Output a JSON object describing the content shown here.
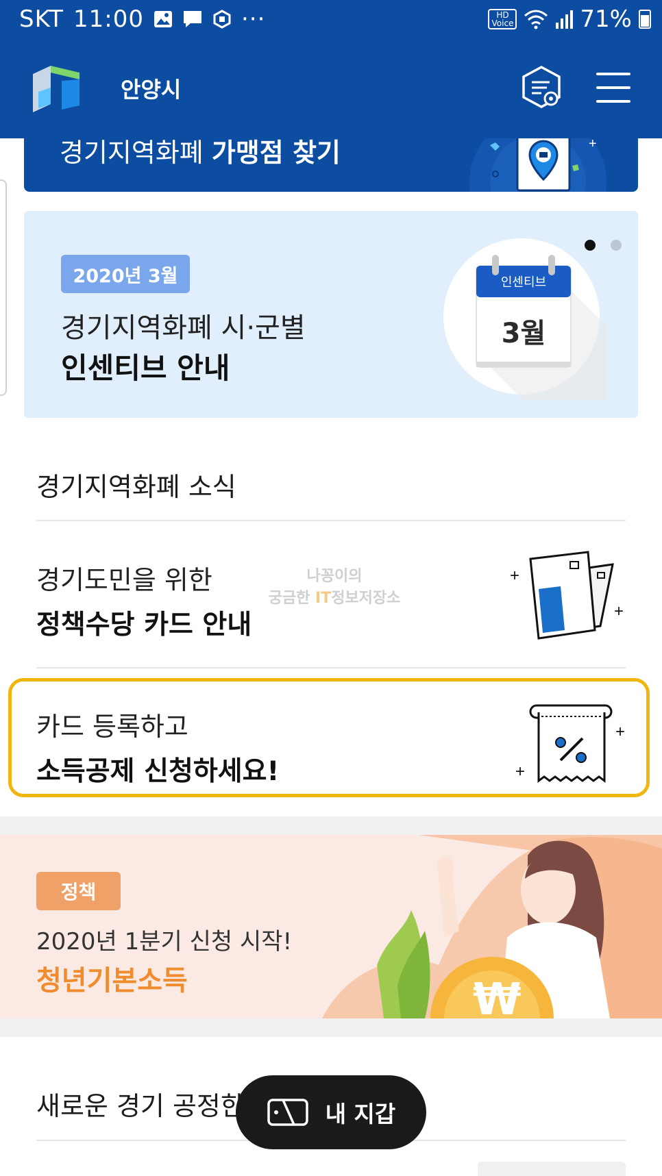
{
  "status_bar": {
    "carrier": "SKT",
    "time": "11:00",
    "overflow": "···",
    "hd_line1": "HD",
    "hd_line2": "Voice",
    "battery": "71%"
  },
  "header": {
    "city": "안양시",
    "icons": [
      "gyeonggi-logo-icon",
      "settings-document-icon",
      "hamburger-menu-icon"
    ]
  },
  "store_banner": {
    "text_regular": "경기지역화폐 ",
    "text_bold": "가맹점 찾기"
  },
  "incentive_banner": {
    "badge": "2020년 3월",
    "line1": "경기지역화폐 시·군별",
    "line2": "인센티브 안내",
    "calendar_header": "인센티브",
    "calendar_month": "3월",
    "active_dot": 0,
    "dot_count": 2
  },
  "news": {
    "title": "경기지역화폐 소식",
    "items": [
      {
        "line1": "경기도민을 위한",
        "line2": "정책수당 카드 안내",
        "icon": "policy-card-icon"
      },
      {
        "line1": "카드 등록하고",
        "line2": "소득공제 신청하세요!",
        "icon": "receipt-percent-icon"
      }
    ]
  },
  "watermark": {
    "line1": "나꽁이의",
    "line2_a": "궁금한 ",
    "line2_it": "IT",
    "line2_b": "정보저장소"
  },
  "youth_banner": {
    "badge": "정책",
    "line1": "2020년 1분기 신청 시작!",
    "line2": "청년기본소득",
    "coin_symbol": "₩"
  },
  "fair_section": {
    "title": "새로운 경기 공정한"
  },
  "wallet_button": {
    "label": "내 지갑",
    "icon": "wallet-icon"
  },
  "colors": {
    "brand_blue": "#0c4da2",
    "highlight": "#f2b50f",
    "youth_accent": "#f08c2e",
    "incentive_bg": "#e1eefb"
  }
}
